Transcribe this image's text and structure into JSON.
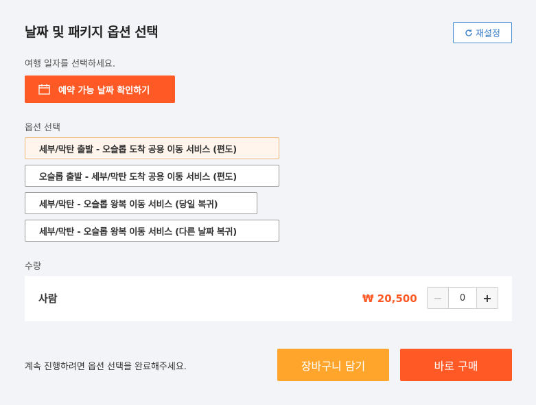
{
  "header": {
    "title": "날짜 및 패키지 옵션 선택",
    "reset_label": "재설정"
  },
  "date": {
    "instruction": "여행 일자를 선택하세요.",
    "button_label": "예약 가능 날짜 확인하기",
    "button_icon": "calendar-icon"
  },
  "options": {
    "label": "옵션 선택",
    "items": [
      {
        "label": "세부/막탄 출발 - 오슬롭 도착 공용 이동 서비스 (편도)",
        "selected": true
      },
      {
        "label": "오슬롭 출발 - 세부/막탄 도착 공용 이동 서비스 (편도)",
        "selected": false
      },
      {
        "label": "세부/막탄 - 오슬롭 왕복 이동 서비스 (당일 복귀)",
        "selected": false
      },
      {
        "label": "세부/막탄 - 오슬롭 왕복 이동 서비스 (다른 날짜 복귀)",
        "selected": false
      }
    ]
  },
  "quantity": {
    "label": "수량",
    "person_label": "사람",
    "price": "₩ 20,500",
    "minus": "−",
    "plus": "+",
    "value": "0"
  },
  "footer": {
    "note": "계속 진행하려면 옵션 선택을 완료해주세요.",
    "cart_label": "장바구니 담기",
    "buy_label": "바로 구매"
  },
  "colors": {
    "accent": "#ff5a26",
    "cart": "#ffa52c",
    "reset_border": "#4a8fd6",
    "selected_bg": "#fff5ec"
  }
}
